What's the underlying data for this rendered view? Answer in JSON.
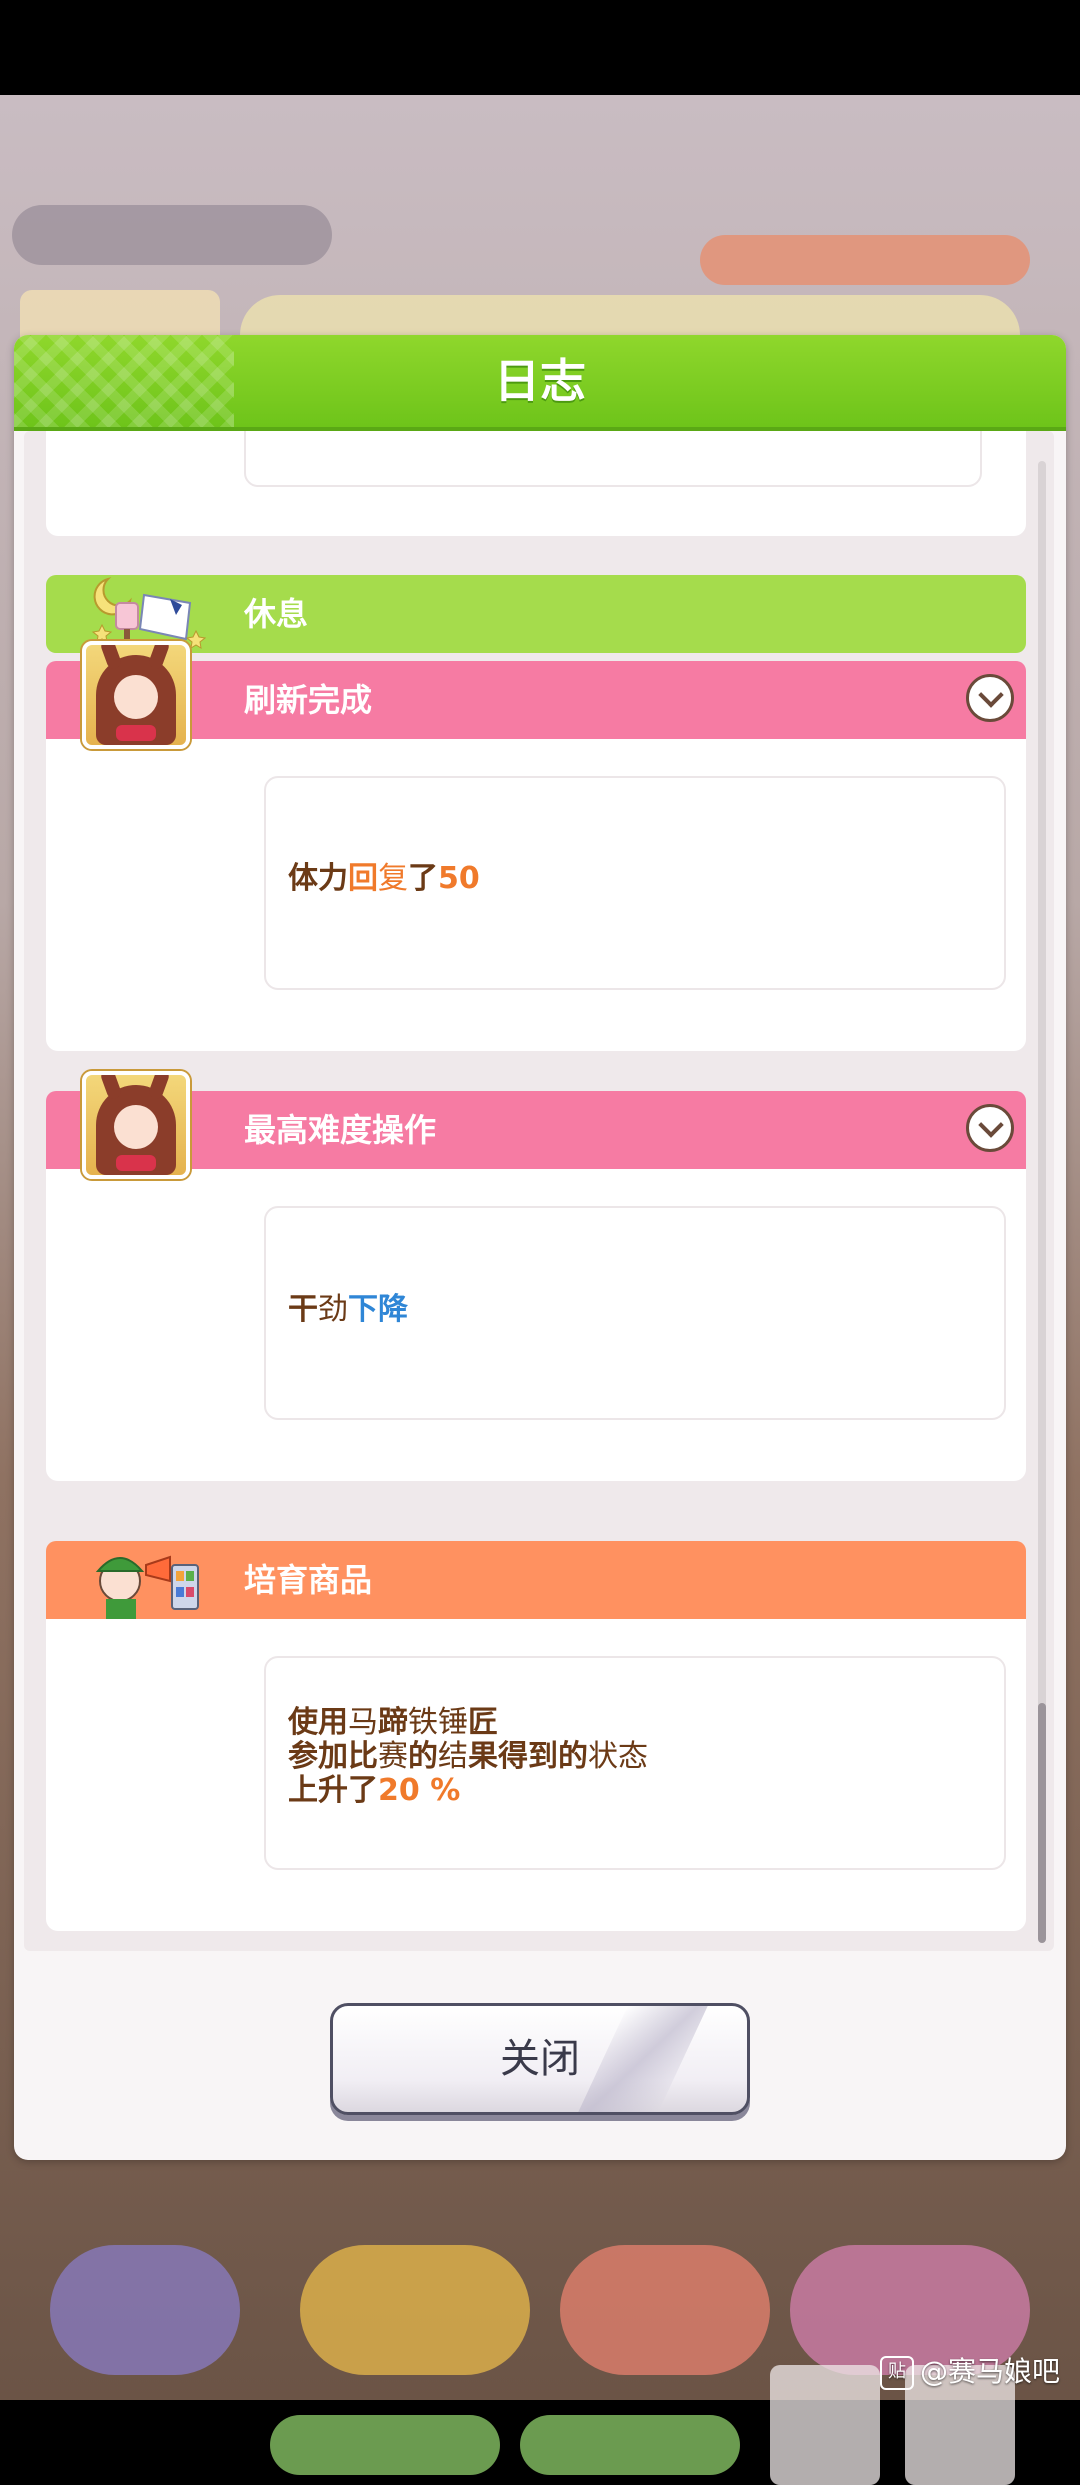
{
  "dialog": {
    "title": "日志"
  },
  "entries": [
    {
      "type": "rest",
      "label": "休息"
    },
    {
      "type": "event",
      "label": "刷新完成",
      "lines": [
        [
          {
            "text": "体力",
            "style": "bold"
          },
          {
            "text": "回",
            "style": "orange"
          },
          {
            "text": "复",
            "style": "plain"
          },
          {
            "text": "了",
            "style": "bold"
          },
          {
            "text": "50",
            "style": "orange"
          }
        ]
      ]
    },
    {
      "type": "event",
      "label": "最高难度操作",
      "lines": [
        [
          {
            "text": "干",
            "style": "bold"
          },
          {
            "text": "劲",
            "style": "plain"
          },
          {
            "text": "下降",
            "style": "blue"
          }
        ]
      ]
    },
    {
      "type": "item",
      "label": "培育商品",
      "lines": [
        [
          {
            "text": "使用",
            "style": "bold"
          },
          {
            "text": "马",
            "style": "plain"
          },
          {
            "text": "蹄",
            "style": "bold"
          },
          {
            "text": "铁锤",
            "style": "plain"
          },
          {
            "text": "匠",
            "style": "bold"
          }
        ],
        [
          {
            "text": "参加比",
            "style": "bold"
          },
          {
            "text": "赛",
            "style": "plain"
          },
          {
            "text": "的",
            "style": "bold"
          },
          {
            "text": "结",
            "style": "plain"
          },
          {
            "text": "果得到的",
            "style": "bold"
          },
          {
            "text": "状",
            "style": "plain"
          },
          {
            "text": "态",
            "style": "plain"
          }
        ],
        [
          {
            "text": "上升了",
            "style": "bold"
          },
          {
            "text": "20 %",
            "style": "orange"
          }
        ]
      ]
    }
  ],
  "close_button": {
    "label": "关闭"
  },
  "watermark": {
    "logo": "贴",
    "text": "@赛马娘吧"
  },
  "colors": {
    "header_green": "#7cce22",
    "rest_bar": "#a5dc4c",
    "event_bar": "#f67ba3",
    "item_bar": "#ff9160",
    "text_brown": "#6b3a16",
    "accent_orange": "#f07a2b",
    "accent_blue": "#2f86d6"
  },
  "icons": {
    "rest": "moon-lamp-pillow-icon",
    "portrait": "character-portrait-icon",
    "shop": "shop-clerk-icon",
    "expand": "chevron-down-icon"
  }
}
